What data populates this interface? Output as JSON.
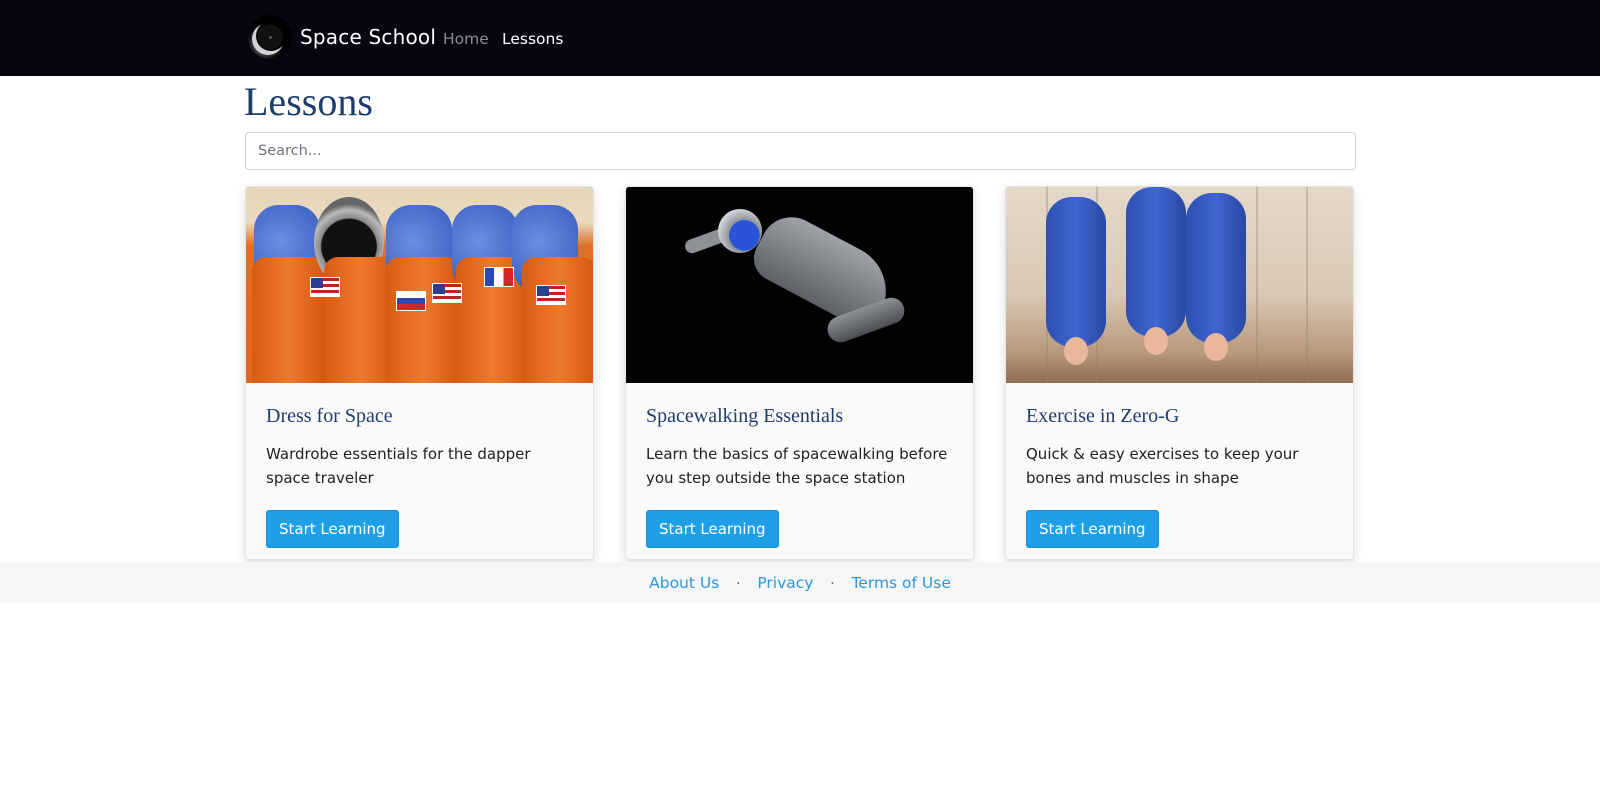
{
  "nav": {
    "brand": "Space School",
    "links": [
      {
        "label": "Home"
      },
      {
        "label": "Lessons"
      }
    ]
  },
  "page": {
    "title": "Lessons",
    "search_placeholder": "Search..."
  },
  "cards": [
    {
      "title": "Dress for Space",
      "text": "Wardrobe essentials for the dapper space traveler",
      "button": "Start Learning"
    },
    {
      "title": "Spacewalking Essentials",
      "text": "Learn the basics of spacewalking before you step outside the space station",
      "button": "Start Learning"
    },
    {
      "title": "Exercise in Zero-G",
      "text": "Quick & easy exercises to keep your bones and muscles in shape",
      "button": "Start Learning"
    }
  ],
  "footer": {
    "links": [
      "About Us",
      "Privacy",
      "Terms of Use"
    ],
    "separator": "·"
  },
  "colors": {
    "navbar": "#05060f",
    "title": "#1f3d6b",
    "button": "#1f9fe8",
    "link": "#2d97d9"
  }
}
